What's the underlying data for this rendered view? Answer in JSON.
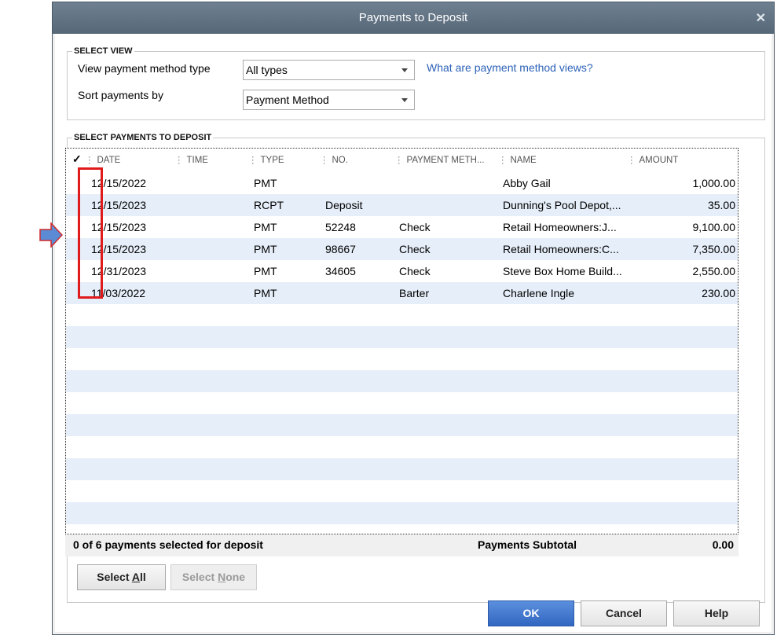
{
  "dialog": {
    "title": "Payments to Deposit"
  },
  "select_view": {
    "group_title": "SELECT VIEW",
    "method_label": "View payment method type",
    "method_value": "All types",
    "help_link": "What are payment method views?",
    "sort_label": "Sort payments by",
    "sort_value": "Payment Method"
  },
  "payments": {
    "group_title": "SELECT PAYMENTS TO DEPOSIT",
    "columns": {
      "check": "✓",
      "date": "DATE",
      "time": "TIME",
      "type": "TYPE",
      "no": "NO.",
      "method": "PAYMENT METH...",
      "name": "NAME",
      "amount": "AMOUNT"
    },
    "rows": [
      {
        "date": "12/15/2022",
        "time": "",
        "type": "PMT",
        "no": "",
        "method": "",
        "name": "Abby Gail",
        "amount": "1,000.00"
      },
      {
        "date": "12/15/2023",
        "time": "",
        "type": "RCPT",
        "no": "Deposit",
        "method": "",
        "name": "Dunning's Pool Depot,...",
        "amount": "35.00"
      },
      {
        "date": "12/15/2023",
        "time": "",
        "type": "PMT",
        "no": "52248",
        "method": "Check",
        "name": "Retail Homeowners:J...",
        "amount": "9,100.00"
      },
      {
        "date": "12/15/2023",
        "time": "",
        "type": "PMT",
        "no": "98667",
        "method": "Check",
        "name": "Retail Homeowners:C...",
        "amount": "7,350.00"
      },
      {
        "date": "12/31/2023",
        "time": "",
        "type": "PMT",
        "no": "34605",
        "method": "Check",
        "name": "Steve Box Home Build...",
        "amount": "2,550.00"
      },
      {
        "date": "11/03/2022",
        "time": "",
        "type": "PMT",
        "no": "",
        "method": "Barter",
        "name": "Charlene Ingle",
        "amount": "230.00"
      }
    ],
    "summary": "0 of 6 payments selected for deposit",
    "subtotal_label": "Payments Subtotal",
    "subtotal_value": "0.00"
  },
  "buttons": {
    "select_all_pre": "Select ",
    "select_all_key": "A",
    "select_all_post": "ll",
    "select_none_pre": "Select ",
    "select_none_key": "N",
    "select_none_post": "one",
    "ok": "OK",
    "cancel": "Cancel",
    "help": "Help"
  },
  "colors": {
    "title_bar": "#5f7081",
    "row_alt": "#e6eef9",
    "primary_button": "#3d71c9",
    "highlight": "#e01b1b",
    "pointer": "#5b8bd4"
  }
}
